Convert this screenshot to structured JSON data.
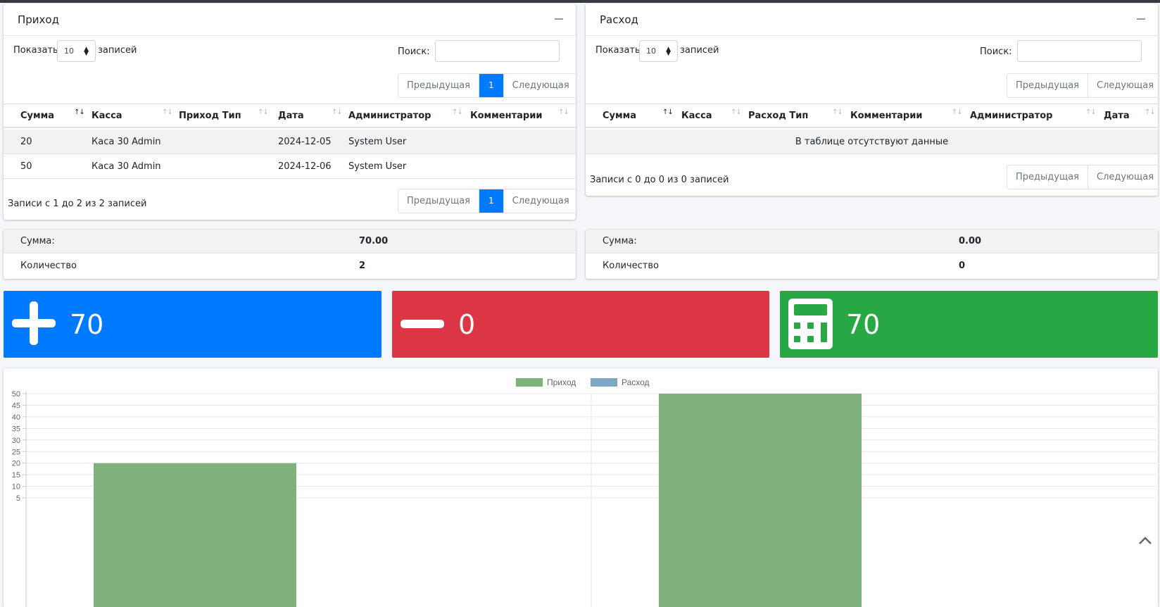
{
  "income": {
    "title": "Приход",
    "show_label": "Показать",
    "show_value": "10",
    "entries_label": "записей",
    "search_label": "Поиск:",
    "search_value": "",
    "pager": {
      "prev": "Предыдущая",
      "page": "1",
      "next": "Следующая"
    },
    "columns": [
      "Сумма",
      "Касса",
      "Приход Тип",
      "Дата",
      "Администратор",
      "Комментарии"
    ],
    "rows": [
      {
        "sum": "20",
        "kassa": "Каса 30 Admin",
        "type": "",
        "date": "2024-12-05",
        "admin": "System User",
        "comment": ""
      },
      {
        "sum": "50",
        "kassa": "Каса 30 Admin",
        "type": "",
        "date": "2024-12-06",
        "admin": "System User",
        "comment": ""
      }
    ],
    "info": "Записи с 1 до 2 из 2 записей"
  },
  "expense": {
    "title": "Расход",
    "show_label": "Показать",
    "show_value": "10",
    "entries_label": "записей",
    "search_label": "Поиск:",
    "search_value": "",
    "pager": {
      "prev": "Предыдущая",
      "next": "Следующая"
    },
    "columns": [
      "Сумма",
      "Касса",
      "Расход Тип",
      "Комментарии",
      "Администратор",
      "Дата"
    ],
    "empty_text": "В таблице отсутствуют данные",
    "info": "Записи с 0 до 0 из 0 записей"
  },
  "income_summary": {
    "sum_label": "Сумма:",
    "sum_value": "70.00",
    "count_label": "Количество",
    "count_value": "2"
  },
  "expense_summary": {
    "sum_label": "Сумма:",
    "sum_value": "0.00",
    "count_label": "Количество",
    "count_value": "0"
  },
  "info_boxes": [
    {
      "icon": "plus-icon",
      "value": "70",
      "color": "#007bff"
    },
    {
      "icon": "minus-icon",
      "value": "0",
      "color": "#dc3545"
    },
    {
      "icon": "calculator-icon",
      "value": "70",
      "color": "#28a745"
    }
  ],
  "chart_data": {
    "type": "bar",
    "categories": [
      "",
      ""
    ],
    "series": [
      {
        "name": "Приход",
        "values": [
          20,
          50
        ],
        "color": "#80b17d"
      },
      {
        "name": "Расход",
        "values": [
          0,
          0
        ],
        "color": "#7ea8bf"
      }
    ],
    "yticks": [
      "50",
      "45",
      "40",
      "35",
      "30",
      "25",
      "20",
      "15",
      "10",
      "5"
    ],
    "ylim": [
      0,
      50
    ],
    "grid": true,
    "legend": "top-center"
  }
}
